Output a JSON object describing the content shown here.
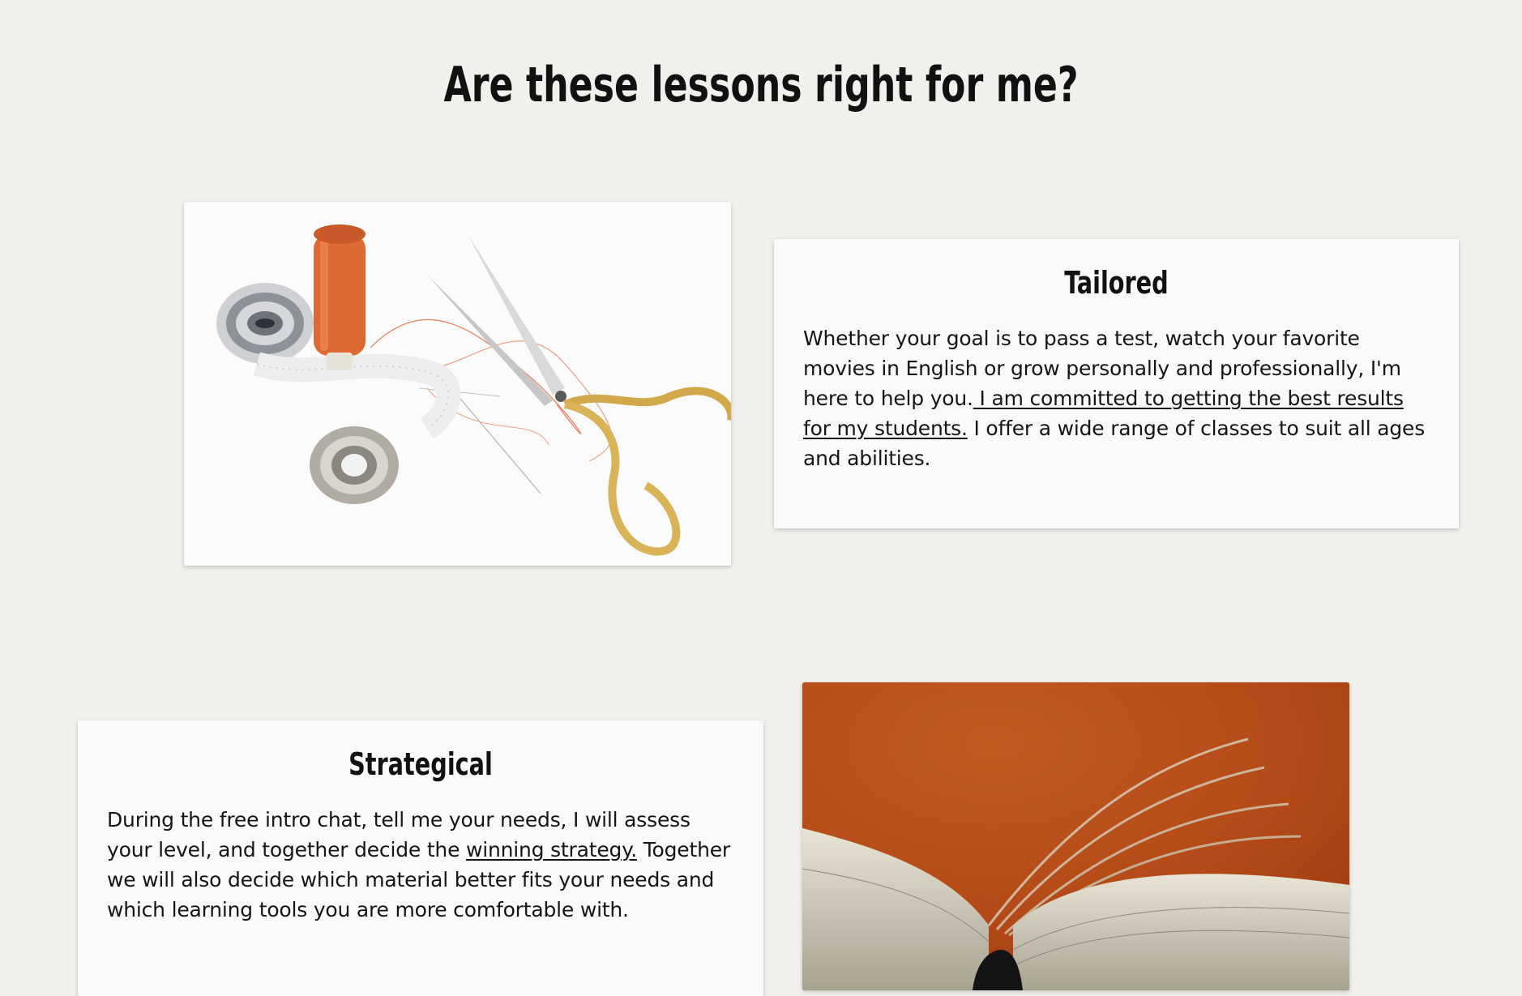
{
  "page": {
    "title": "Are these lessons right for me?"
  },
  "sections": [
    {
      "heading": "Tailored",
      "text_before_link": "Whether your goal is to pass a test, watch your favorite movies in English or grow personally and professionally, I'm here to help you.",
      "link_text": " I am committed to getting the best results for my students.",
      "text_after_link": " I offer a wide range of classes to suit all ages and abilities.",
      "image": "sewing-tools-photo"
    },
    {
      "heading": "Strategical",
      "text_before_link": "During the free intro chat, tell me your needs, I will assess your level, and together decide the ",
      "link_text": "winning strategy.",
      "text_after_link": " Together we will also decide which material better fits your needs and which learning tools you are more comfortable with.",
      "image": "open-book-photo"
    }
  ],
  "colors": {
    "background": "#f1f0ec",
    "card": "#fafafa",
    "text": "#151515",
    "accent_orange": "#c4531f"
  }
}
